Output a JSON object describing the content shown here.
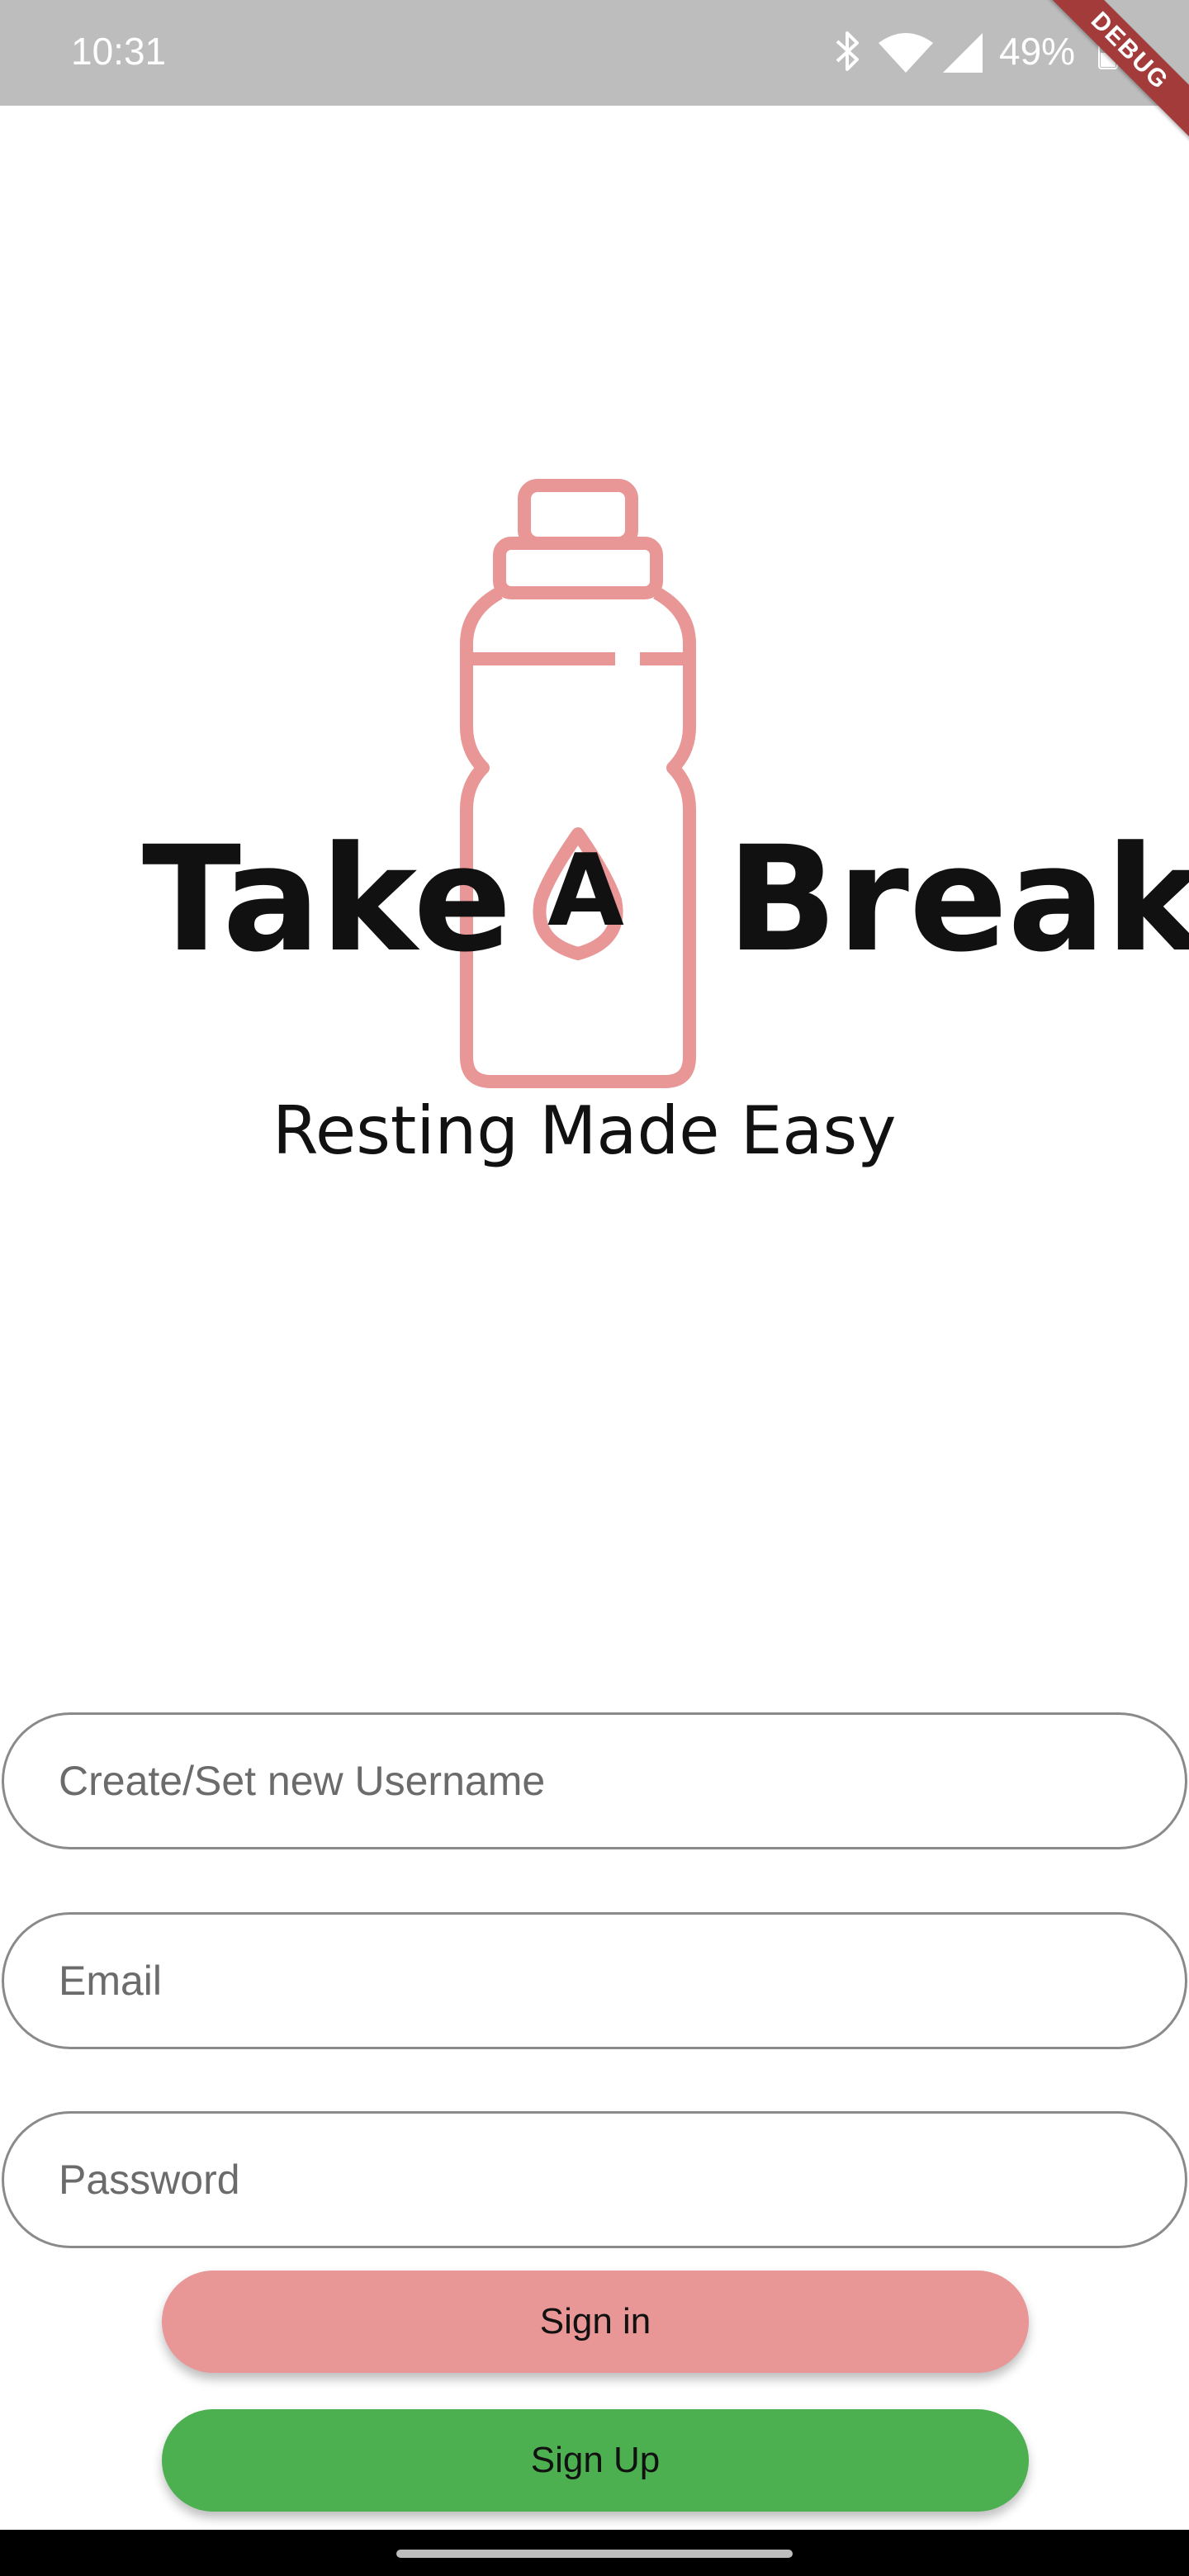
{
  "status_bar": {
    "time": "10:31",
    "battery": "49%",
    "icons": [
      "bluetooth-icon",
      "wifi-icon",
      "signal-icon",
      "battery-icon"
    ]
  },
  "debug_banner": "DEBUG",
  "logo": {
    "word_left": "Take",
    "drop_letter": "A",
    "word_right": "Break",
    "tagline": "Resting Made Easy",
    "bottle_color": "#e89696"
  },
  "form": {
    "username_placeholder": "Create/Set new Username",
    "email_placeholder": "Email",
    "password_placeholder": "Password"
  },
  "buttons": {
    "sign_in": "Sign in",
    "sign_up": "Sign Up",
    "sign_in_color": "#e89696",
    "sign_up_color": "#4caf50"
  }
}
